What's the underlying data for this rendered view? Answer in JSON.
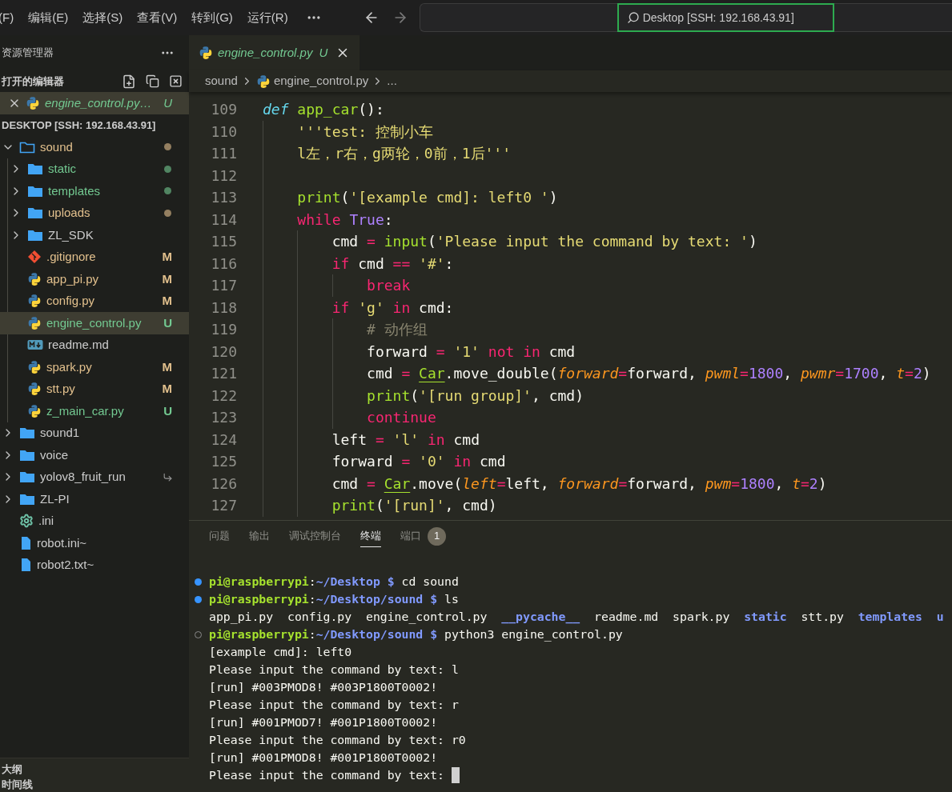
{
  "menu": [
    {
      "label": "(F)"
    },
    {
      "label": "编辑(E)"
    },
    {
      "label": "选择(S)"
    },
    {
      "label": "查看(V)"
    },
    {
      "label": "转到(G)"
    },
    {
      "label": "运行(R)"
    }
  ],
  "search": {
    "value": "Desktop [SSH: 192.168.43.91]",
    "highlighted": true
  },
  "sidebar": {
    "title": "资源管理器",
    "open_editors": {
      "title": "打开的编辑器",
      "items": [
        {
          "name": "engine_control.py…",
          "badge": "U",
          "color": "#73c991",
          "selected": true
        }
      ]
    },
    "root": "DESKTOP [SSH: 192.168.43.91]",
    "tree": [
      {
        "name": "sound",
        "kind": "folder",
        "expanded": true,
        "dot": true,
        "symlink": false,
        "color": "#e2c08d",
        "selected": false,
        "children": [
          {
            "name": "static",
            "kind": "folder",
            "expanded": false,
            "dot": true,
            "symlink": false,
            "color": "#73c991",
            "selected": false
          },
          {
            "name": "templates",
            "kind": "folder",
            "expanded": false,
            "dot": true,
            "symlink": false,
            "color": "#73c991",
            "selected": false
          },
          {
            "name": "uploads",
            "kind": "folder",
            "expanded": false,
            "dot": true,
            "symlink": false,
            "color": "#e2c08d",
            "selected": false
          },
          {
            "name": "ZL_SDK",
            "kind": "folder",
            "expanded": false,
            "dot": false,
            "symlink": false,
            "color": "#cccccc",
            "selected": false
          },
          {
            "name": ".gitignore",
            "kind": "git",
            "badge": "M",
            "dot": false,
            "symlink": false,
            "color": "#e2c08d",
            "selected": false
          },
          {
            "name": "app_pi.py",
            "kind": "python",
            "badge": "M",
            "dot": false,
            "symlink": false,
            "color": "#e2c08d",
            "selected": false
          },
          {
            "name": "config.py",
            "kind": "python",
            "badge": "M",
            "dot": false,
            "symlink": false,
            "color": "#e2c08d",
            "selected": false
          },
          {
            "name": "engine_control.py",
            "kind": "python",
            "badge": "U",
            "dot": false,
            "symlink": false,
            "color": "#73c991",
            "selected": true
          },
          {
            "name": "readme.md",
            "kind": "markdown",
            "dot": false,
            "symlink": false,
            "color": "#cccccc",
            "selected": false
          },
          {
            "name": "spark.py",
            "kind": "python",
            "badge": "M",
            "dot": false,
            "symlink": false,
            "color": "#e2c08d",
            "selected": false
          },
          {
            "name": "stt.py",
            "kind": "python",
            "badge": "M",
            "dot": false,
            "symlink": false,
            "color": "#e2c08d",
            "selected": false
          },
          {
            "name": "z_main_car.py",
            "kind": "python",
            "badge": "U",
            "dot": false,
            "symlink": false,
            "color": "#73c991",
            "selected": false
          }
        ]
      },
      {
        "name": "sound1",
        "kind": "folder",
        "expanded": false,
        "dot": false,
        "symlink": false,
        "color": "#cccccc",
        "selected": false
      },
      {
        "name": "voice",
        "kind": "folder",
        "expanded": false,
        "dot": false,
        "symlink": false,
        "color": "#cccccc",
        "selected": false
      },
      {
        "name": "yolov8_fruit_run",
        "kind": "folder",
        "expanded": false,
        "dot": false,
        "symlink": true,
        "color": "#cccccc",
        "selected": false
      },
      {
        "name": "ZL-PI",
        "kind": "folder",
        "expanded": false,
        "dot": false,
        "symlink": false,
        "color": "#cccccc",
        "selected": false
      },
      {
        "name": ".ini",
        "kind": "gear",
        "dot": false,
        "symlink": false,
        "color": "#cccccc",
        "selected": false
      },
      {
        "name": "robot.ini~",
        "kind": "file",
        "dot": false,
        "symlink": false,
        "color": "#cccccc",
        "selected": false
      },
      {
        "name": "robot2.txt~",
        "kind": "file",
        "dot": false,
        "symlink": false,
        "color": "#cccccc",
        "selected": false
      }
    ],
    "outline": "大纲",
    "timeline": "时间线"
  },
  "tabs": [
    {
      "label": "engine_control.py",
      "badge": "U",
      "selected": true
    }
  ],
  "breadcrumb": [
    {
      "label": "sound",
      "kind": "folder"
    },
    {
      "label": "engine_control.py",
      "kind": "python"
    },
    {
      "label": "...",
      "kind": "more"
    }
  ],
  "code": [
    {
      "number": "109",
      "tokens": [
        {
          "t": "def ",
          "kind": "def"
        },
        {
          "t": "app_car",
          "kind": "fn"
        },
        {
          "t": "():",
          "kind": "plain"
        }
      ]
    },
    {
      "number": "110",
      "tokens": [
        {
          "t": "    '''test: 控制小车",
          "kind": "str"
        }
      ]
    },
    {
      "number": "111",
      "tokens": [
        {
          "t": "    l左，r右，g两轮，0前，1后'''",
          "kind": "str"
        }
      ]
    },
    {
      "number": "112"
    },
    {
      "number": "113",
      "tokens": [
        {
          "t": "    print",
          "kind": "fn"
        },
        {
          "t": "(",
          "kind": "plain"
        },
        {
          "t": "'[example cmd]: left0 '",
          "kind": "str"
        },
        {
          "t": ")",
          "kind": "plain"
        }
      ]
    },
    {
      "number": "114",
      "tokens": [
        {
          "t": "    while ",
          "kind": "kw"
        },
        {
          "t": "True",
          "kind": "const"
        },
        {
          "t": ":",
          "kind": "plain"
        }
      ]
    },
    {
      "number": "115",
      "tokens": [
        {
          "t": "        cmd ",
          "kind": "plain"
        },
        {
          "t": "= ",
          "kind": "kw"
        },
        {
          "t": "input",
          "kind": "fn"
        },
        {
          "t": "(",
          "kind": "plain"
        },
        {
          "t": "'Please input the command by text: '",
          "kind": "str"
        },
        {
          "t": ")",
          "kind": "plain"
        }
      ]
    },
    {
      "number": "116",
      "tokens": [
        {
          "t": "        if ",
          "kind": "kw"
        },
        {
          "t": "cmd ",
          "kind": "plain"
        },
        {
          "t": "== ",
          "kind": "kw"
        },
        {
          "t": "'#'",
          "kind": "str"
        },
        {
          "t": ":",
          "kind": "plain"
        }
      ]
    },
    {
      "number": "117",
      "tokens": [
        {
          "t": "            break",
          "kind": "kw"
        }
      ]
    },
    {
      "number": "118",
      "tokens": [
        {
          "t": "        if ",
          "kind": "kw"
        },
        {
          "t": "'g' ",
          "kind": "str"
        },
        {
          "t": "in ",
          "kind": "kw"
        },
        {
          "t": "cmd:",
          "kind": "plain"
        }
      ]
    },
    {
      "number": "119",
      "tokens": [
        {
          "t": "            # 动作组",
          "kind": "comment"
        }
      ]
    },
    {
      "number": "120",
      "tokens": [
        {
          "t": "            forward ",
          "kind": "plain"
        },
        {
          "t": "= ",
          "kind": "kw"
        },
        {
          "t": "'1' ",
          "kind": "str"
        },
        {
          "t": "not in ",
          "kind": "kw"
        },
        {
          "t": "cmd",
          "kind": "plain"
        }
      ]
    },
    {
      "number": "121",
      "tokens": [
        {
          "t": "            cmd ",
          "kind": "plain"
        },
        {
          "t": "= ",
          "kind": "kw"
        },
        {
          "t": "Car",
          "kind": "cls"
        },
        {
          "t": ".move_double(",
          "kind": "plain"
        },
        {
          "t": "forward",
          "kind": "param"
        },
        {
          "t": "=",
          "kind": "kw"
        },
        {
          "t": "forward, ",
          "kind": "plain"
        },
        {
          "t": "pwml",
          "kind": "param"
        },
        {
          "t": "=",
          "kind": "kw"
        },
        {
          "t": "1800",
          "kind": "const"
        },
        {
          "t": ", ",
          "kind": "plain"
        },
        {
          "t": "pwmr",
          "kind": "param"
        },
        {
          "t": "=",
          "kind": "kw"
        },
        {
          "t": "1700",
          "kind": "const"
        },
        {
          "t": ", ",
          "kind": "plain"
        },
        {
          "t": "t",
          "kind": "param"
        },
        {
          "t": "=",
          "kind": "kw"
        },
        {
          "t": "2",
          "kind": "const"
        },
        {
          "t": ")",
          "kind": "plain"
        }
      ]
    },
    {
      "number": "122",
      "tokens": [
        {
          "t": "            print",
          "kind": "fn"
        },
        {
          "t": "(",
          "kind": "plain"
        },
        {
          "t": "'[run group]'",
          "kind": "str"
        },
        {
          "t": ", cmd)",
          "kind": "plain"
        }
      ]
    },
    {
      "number": "123",
      "tokens": [
        {
          "t": "            continue",
          "kind": "kw"
        }
      ]
    },
    {
      "number": "124",
      "tokens": [
        {
          "t": "        left ",
          "kind": "plain"
        },
        {
          "t": "= ",
          "kind": "kw"
        },
        {
          "t": "'l' ",
          "kind": "str"
        },
        {
          "t": "in ",
          "kind": "kw"
        },
        {
          "t": "cmd",
          "kind": "plain"
        }
      ]
    },
    {
      "number": "125",
      "tokens": [
        {
          "t": "        forward ",
          "kind": "plain"
        },
        {
          "t": "= ",
          "kind": "kw"
        },
        {
          "t": "'0' ",
          "kind": "str"
        },
        {
          "t": "in ",
          "kind": "kw"
        },
        {
          "t": "cmd",
          "kind": "plain"
        }
      ]
    },
    {
      "number": "126",
      "tokens": [
        {
          "t": "        cmd ",
          "kind": "plain"
        },
        {
          "t": "= ",
          "kind": "kw"
        },
        {
          "t": "Car",
          "kind": "cls"
        },
        {
          "t": ".move(",
          "kind": "plain"
        },
        {
          "t": "left",
          "kind": "param"
        },
        {
          "t": "=",
          "kind": "kw"
        },
        {
          "t": "left, ",
          "kind": "plain"
        },
        {
          "t": "forward",
          "kind": "param"
        },
        {
          "t": "=",
          "kind": "kw"
        },
        {
          "t": "forward, ",
          "kind": "plain"
        },
        {
          "t": "pwm",
          "kind": "param"
        },
        {
          "t": "=",
          "kind": "kw"
        },
        {
          "t": "1800",
          "kind": "const"
        },
        {
          "t": ", ",
          "kind": "plain"
        },
        {
          "t": "t",
          "kind": "param"
        },
        {
          "t": "=",
          "kind": "kw"
        },
        {
          "t": "2",
          "kind": "const"
        },
        {
          "t": ")",
          "kind": "plain"
        }
      ]
    },
    {
      "number": "127",
      "tokens": [
        {
          "t": "        print",
          "kind": "fn"
        },
        {
          "t": "(",
          "kind": "plain"
        },
        {
          "t": "'[run]'",
          "kind": "str"
        },
        {
          "t": ", cmd)",
          "kind": "plain"
        }
      ]
    }
  ],
  "panel": {
    "tabs": [
      {
        "label": "问题",
        "selected": false
      },
      {
        "label": "输出",
        "selected": false
      },
      {
        "label": "调试控制台",
        "selected": false
      },
      {
        "label": "终端",
        "selected": true
      },
      {
        "label": "端口",
        "selected": false,
        "badge": "1"
      }
    ],
    "terminal": [
      {
        "kind": "success",
        "tokens": [
          {
            "t": "pi@raspberrypi",
            "kind": "user"
          },
          {
            "t": ":",
            "kind": "plain"
          },
          {
            "t": "~/Desktop $ ",
            "kind": "path"
          },
          {
            "t": "cd sound",
            "kind": "plain"
          }
        ]
      },
      {
        "kind": "success",
        "tokens": [
          {
            "t": "pi@raspberrypi",
            "kind": "user"
          },
          {
            "t": ":",
            "kind": "plain"
          },
          {
            "t": "~/Desktop/sound $ ",
            "kind": "path"
          },
          {
            "t": "ls",
            "kind": "plain"
          }
        ]
      },
      {
        "kind": "output",
        "tokens": [
          {
            "t": "app_pi.py  config.py  engine_control.py  ",
            "kind": "plain"
          },
          {
            "t": "__pycache__",
            "kind": "dir"
          },
          {
            "t": "  readme.md  spark.py  ",
            "kind": "plain"
          },
          {
            "t": "static",
            "kind": "dir"
          },
          {
            "t": "  stt.py  ",
            "kind": "plain"
          },
          {
            "t": "templates",
            "kind": "dir"
          },
          {
            "t": "  u",
            "kind": "dir"
          }
        ]
      },
      {
        "kind": "running",
        "tokens": [
          {
            "t": "pi@raspberrypi",
            "kind": "user"
          },
          {
            "t": ":",
            "kind": "plain"
          },
          {
            "t": "~/Desktop/sound $ ",
            "kind": "path"
          },
          {
            "t": "python3 engine_control.py",
            "kind": "plain"
          }
        ]
      },
      {
        "kind": "output",
        "tokens": [
          {
            "t": "[example cmd]: left0",
            "kind": "plain"
          }
        ]
      },
      {
        "kind": "output",
        "tokens": [
          {
            "t": "Please input the command by text: l",
            "kind": "plain"
          }
        ]
      },
      {
        "kind": "output",
        "tokens": [
          {
            "t": "[run] #003PMOD8! #003P1800T0002!",
            "kind": "plain"
          }
        ]
      },
      {
        "kind": "output",
        "tokens": [
          {
            "t": "Please input the command by text: r",
            "kind": "plain"
          }
        ]
      },
      {
        "kind": "output",
        "tokens": [
          {
            "t": "[run] #001PMOD7! #001P1800T0002!",
            "kind": "plain"
          }
        ]
      },
      {
        "kind": "output",
        "tokens": [
          {
            "t": "Please input the command by text: r0",
            "kind": "plain"
          }
        ]
      },
      {
        "kind": "output",
        "tokens": [
          {
            "t": "[run] #001PMOD8! #001P1800T0002!",
            "kind": "plain"
          }
        ]
      },
      {
        "kind": "output",
        "cursor": true,
        "tokens": [
          {
            "t": "Please input the command by text: ",
            "kind": "plain"
          }
        ]
      }
    ]
  }
}
